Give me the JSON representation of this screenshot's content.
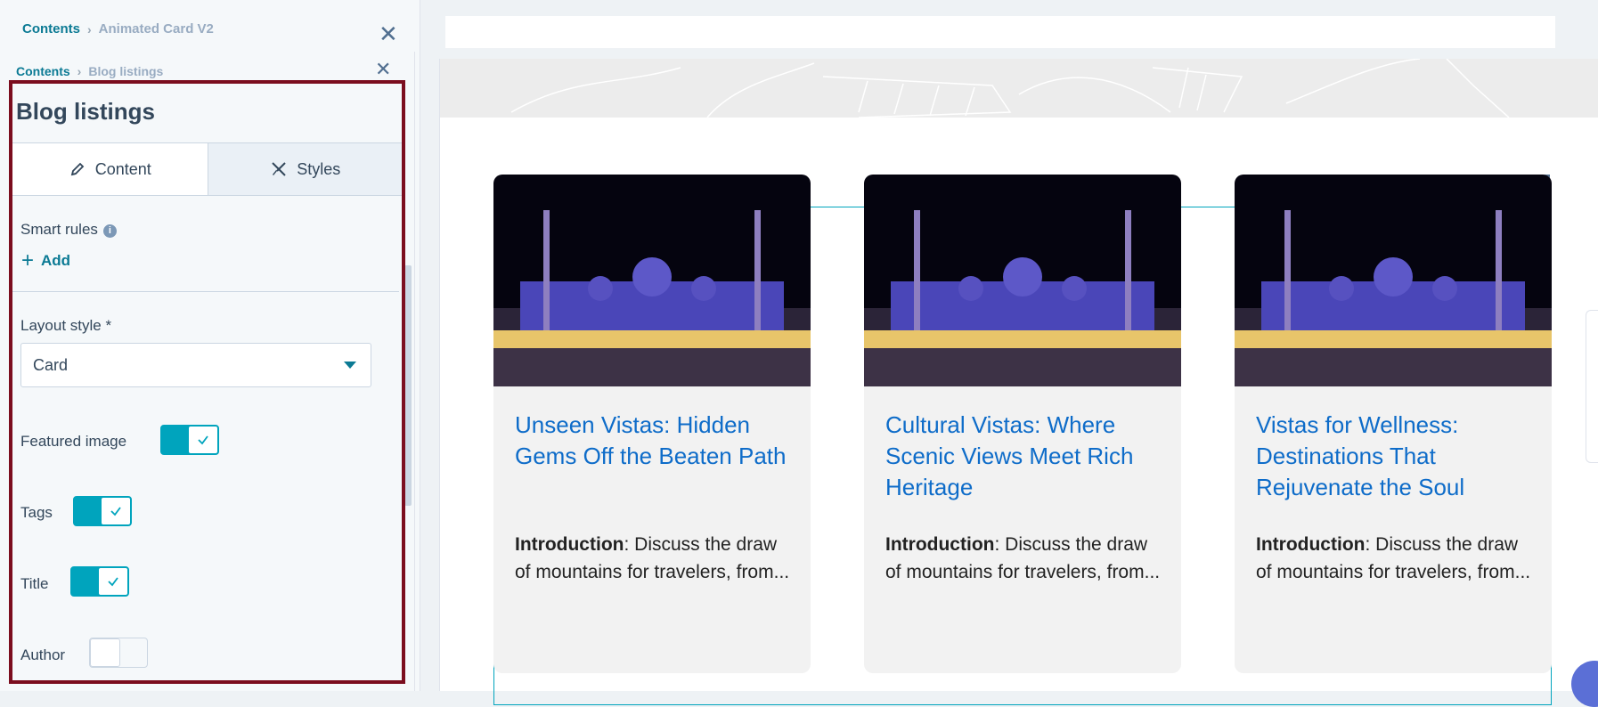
{
  "back_breadcrumb": {
    "parent": "Contents",
    "sep": "›",
    "current": "Animated Card V2"
  },
  "breadcrumb": {
    "parent": "Contents",
    "sep": "›",
    "current": "Blog listings"
  },
  "close_glyph": "✕",
  "panel": {
    "title": "Blog listings",
    "tabs": [
      {
        "label": "Content",
        "icon": "pencil-icon",
        "active": true
      },
      {
        "label": "Styles",
        "icon": "brush-tools-icon",
        "active": false
      }
    ],
    "smart_rules": {
      "label": "Smart rules",
      "info": "i",
      "add_label": "Add"
    },
    "layout_style": {
      "label": "Layout style *",
      "value": "Card"
    },
    "toggles": [
      {
        "label": "Featured image",
        "on": true
      },
      {
        "label": "Tags",
        "on": true
      },
      {
        "label": "Title",
        "on": true
      },
      {
        "label": "Author",
        "on": false
      }
    ]
  },
  "cards": [
    {
      "title": "Unseen Vistas: Hidden Gems Off the Beaten Path",
      "intro_label": "Introduction",
      "intro_text": ": Discuss the draw of mountains for travelers, from..."
    },
    {
      "title": "Cultural Vistas: Where Scenic Views Meet Rich Heritage",
      "intro_label": "Introduction",
      "intro_text": ": Discuss the draw of mountains for travelers, from..."
    },
    {
      "title": "Vistas for Wellness: Destinations That Rejuvenate the Soul",
      "intro_label": "Introduction",
      "intro_text": ": Discuss the draw of mountains for travelers, from..."
    }
  ],
  "colors": {
    "accent": "#00a4bd",
    "link": "#0b7a94",
    "highlight_border": "#7b0d1e",
    "card_title": "#0e6cc9"
  }
}
